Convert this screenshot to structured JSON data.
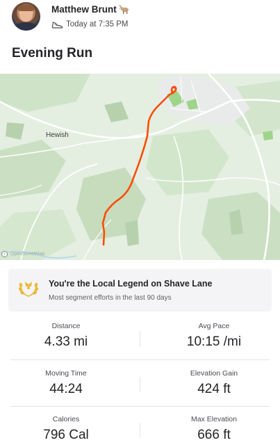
{
  "athlete": {
    "name": "Matthew Brunt",
    "badge_icon": "goat-icon",
    "activity_icon": "running-shoe-icon",
    "timestamp": "Today at 7:35 PM"
  },
  "activity": {
    "title": "Evening Run"
  },
  "map": {
    "place_label": "Hewish",
    "attribution": "OpenStreetMap",
    "route_color": "#fc4c02"
  },
  "local_legend": {
    "icon": "laurel-wreath-icon",
    "title": "You're the Local Legend on Shave Lane",
    "subtitle": "Most segment efforts in the last 90 days"
  },
  "stats": [
    {
      "label": "Distance",
      "value": "4.33 mi"
    },
    {
      "label": "Avg Pace",
      "value": "10:15 /mi"
    },
    {
      "label": "Moving Time",
      "value": "44:24"
    },
    {
      "label": "Elevation Gain",
      "value": "424 ft"
    },
    {
      "label": "Calories",
      "value": "796 Cal"
    },
    {
      "label": "Max Elevation",
      "value": "666 ft"
    }
  ],
  "colors": {
    "accent": "#fc4c02",
    "legend_gold": "#e8b93a",
    "text": "#242428"
  }
}
